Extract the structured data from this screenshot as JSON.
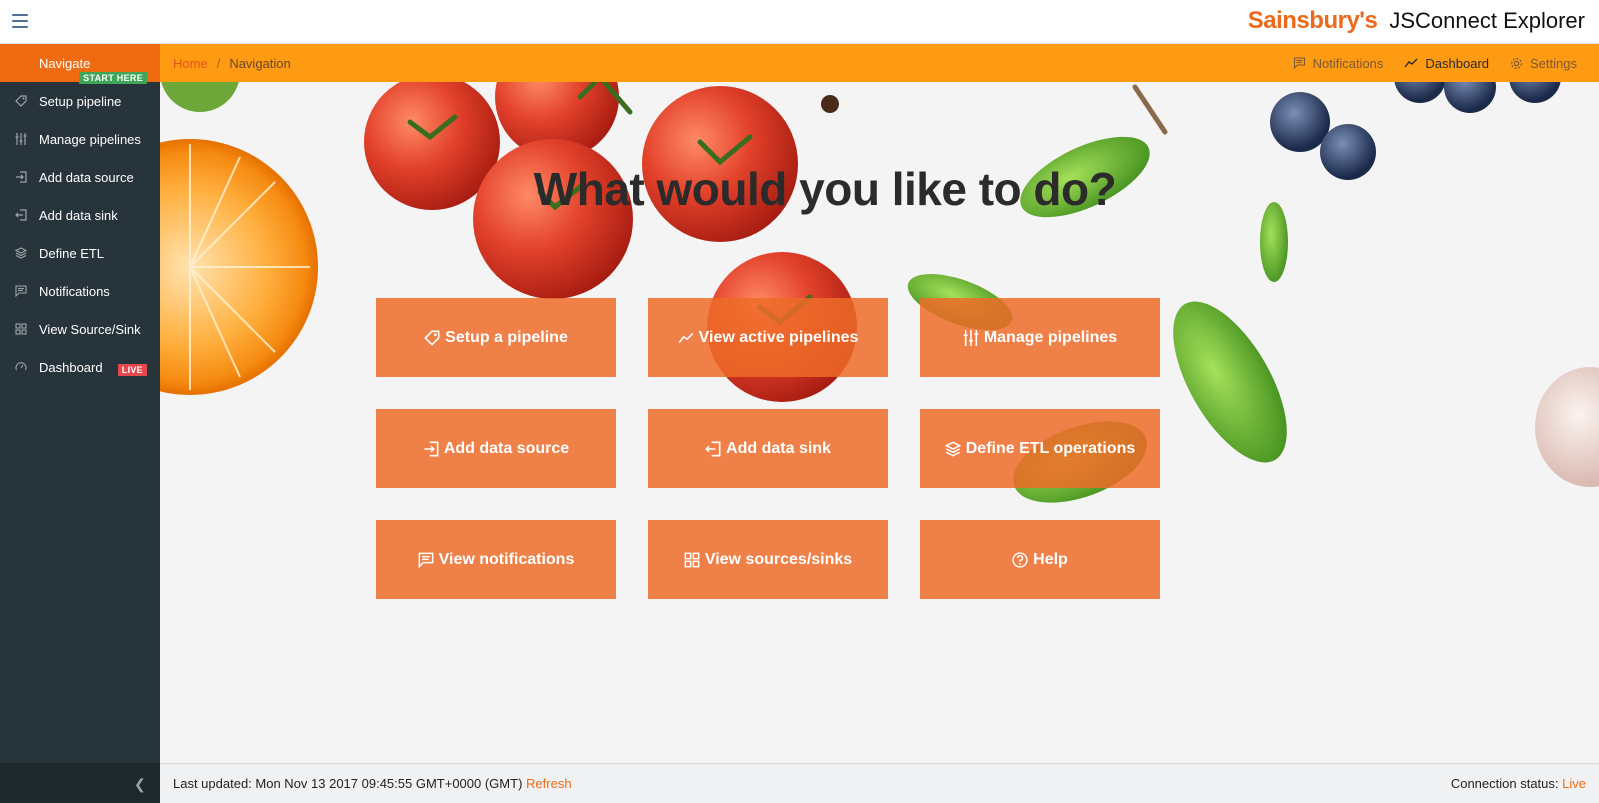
{
  "header": {
    "brand_logo": "Sainsbury's",
    "app_title": "JSConnect Explorer"
  },
  "sidebar": {
    "items": [
      {
        "label": "Navigate",
        "badge": "START HERE",
        "icon": "none"
      },
      {
        "label": "Setup pipeline",
        "icon": "tag-icon"
      },
      {
        "label": "Manage pipelines",
        "icon": "sliders-icon"
      },
      {
        "label": "Add data source",
        "icon": "login-icon"
      },
      {
        "label": "Add data sink",
        "icon": "logout-icon"
      },
      {
        "label": "Define ETL",
        "icon": "layers-icon"
      },
      {
        "label": "Notifications",
        "icon": "message-icon"
      },
      {
        "label": "View Source/Sink",
        "icon": "grid-icon"
      },
      {
        "label": "Dashboard",
        "badge": "LIVE",
        "icon": "gauge-icon"
      }
    ]
  },
  "breadcrumb": {
    "home": "Home",
    "separator": "/",
    "current": "Navigation"
  },
  "toplinks": {
    "notifications": "Notifications",
    "dashboard": "Dashboard",
    "settings": "Settings"
  },
  "main": {
    "headline": "What would you like to do?",
    "tiles": [
      {
        "label": "Setup a pipeline",
        "icon": "tag-icon"
      },
      {
        "label": "View active pipelines",
        "icon": "line-chart-icon"
      },
      {
        "label": "Manage pipelines",
        "icon": "sliders-icon"
      },
      {
        "label": "Add data source",
        "icon": "login-icon"
      },
      {
        "label": "Add data sink",
        "icon": "logout-icon"
      },
      {
        "label": "Define ETL operations",
        "icon": "layers-icon"
      },
      {
        "label": "View notifications",
        "icon": "message-icon"
      },
      {
        "label": "View sources/sinks",
        "icon": "grid-icon"
      },
      {
        "label": "Help",
        "icon": "question-icon"
      }
    ]
  },
  "footer": {
    "last_updated_label": "Last updated: Mon Nov 13 2017 09:45:55 GMT+0000 (GMT)",
    "refresh_label": "Refresh",
    "connection_label": "Connection status:",
    "connection_value": "Live"
  },
  "colors": {
    "accent": "#ef6b12",
    "crumb_bar": "#fe9b12",
    "sidebar_bg": "#28343b",
    "tile": "#ed6b28",
    "badge_start": "#3ea656",
    "badge_live": "#e4474c"
  }
}
